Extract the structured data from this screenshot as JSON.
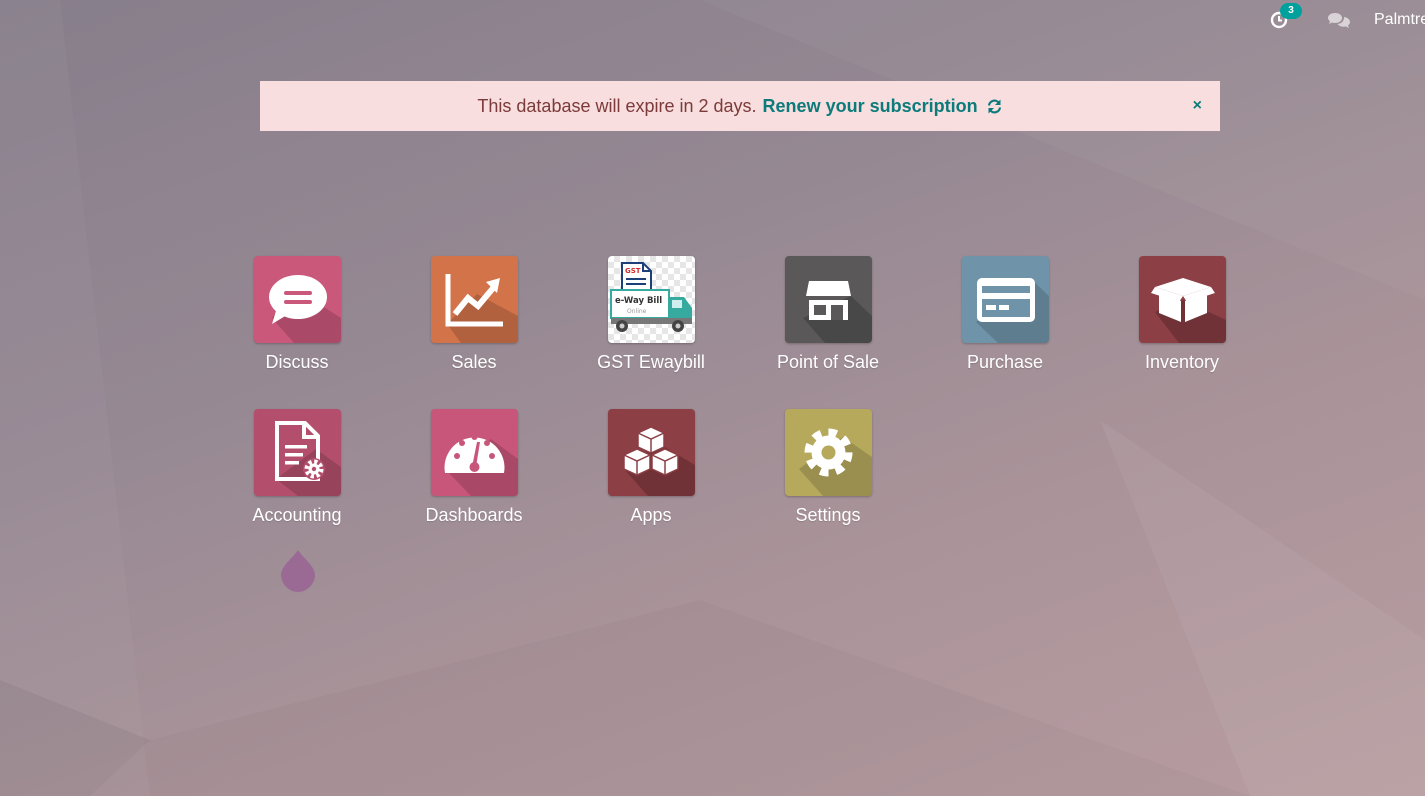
{
  "topbar": {
    "activity_badge": "3",
    "user_name": "Palmtree"
  },
  "alert": {
    "message": "This database will expire in 2 days.",
    "link_label": "Renew your subscription",
    "close_label": "×"
  },
  "apps": [
    {
      "label": "Discuss",
      "icon": "chat-bubble-icon",
      "color": "#c9587b"
    },
    {
      "label": "Sales",
      "icon": "trend-chart-icon",
      "color": "#d2734a"
    },
    {
      "label": "GST Ewaybill",
      "icon": "eway-bill-truck-icon",
      "image_text": [
        "GST",
        "e-Way Bill",
        "Online"
      ]
    },
    {
      "label": "Point of Sale",
      "icon": "shop-icon",
      "color": "#5a5859"
    },
    {
      "label": "Purchase",
      "icon": "credit-card-icon",
      "color": "#6f93a8"
    },
    {
      "label": "Inventory",
      "icon": "box-icon",
      "color": "#8c3f45"
    },
    {
      "label": "Accounting",
      "icon": "document-gear-icon",
      "color": "#b34f6d"
    },
    {
      "label": "Dashboards",
      "icon": "gauge-icon",
      "color": "#c8567a"
    },
    {
      "label": "Apps",
      "icon": "cubes-icon",
      "color": "#8c3f45"
    },
    {
      "label": "Settings",
      "icon": "gear-icon",
      "color": "#b6a95c"
    }
  ],
  "colors": {
    "alert_bg": "#f8dede",
    "alert_text": "#7c3a3a",
    "link": "#0c7b7b",
    "badge": "#00a09d"
  }
}
